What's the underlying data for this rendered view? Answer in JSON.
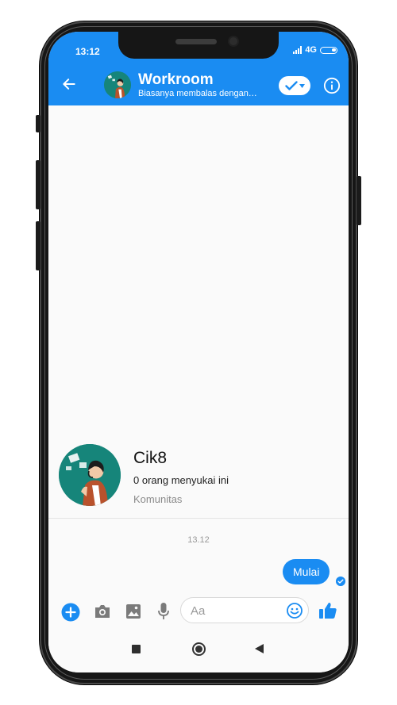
{
  "status_bar": {
    "time": "13:12",
    "network": "4G"
  },
  "header": {
    "title": "Workroom",
    "subtitle": "Biasanya membalas dengan…"
  },
  "profile": {
    "name": "Cik8",
    "likes": "0 orang menyukai ini",
    "category": "Komunitas"
  },
  "messages": [
    {
      "timestamp": "13.12",
      "text": "Mulai",
      "from": "me"
    }
  ],
  "composer": {
    "placeholder": "Aa"
  },
  "colors": {
    "accent": "#1a8cf2",
    "avatar_bg": "#16857a"
  },
  "icons": {
    "back": "arrow-left-icon",
    "check": "check-dropdown-icon",
    "info": "info-icon",
    "plus": "plus-circle-icon",
    "camera": "camera-icon",
    "gallery": "image-icon",
    "mic": "mic-icon",
    "emoji": "emoji-icon",
    "like": "thumbs-up-icon"
  }
}
